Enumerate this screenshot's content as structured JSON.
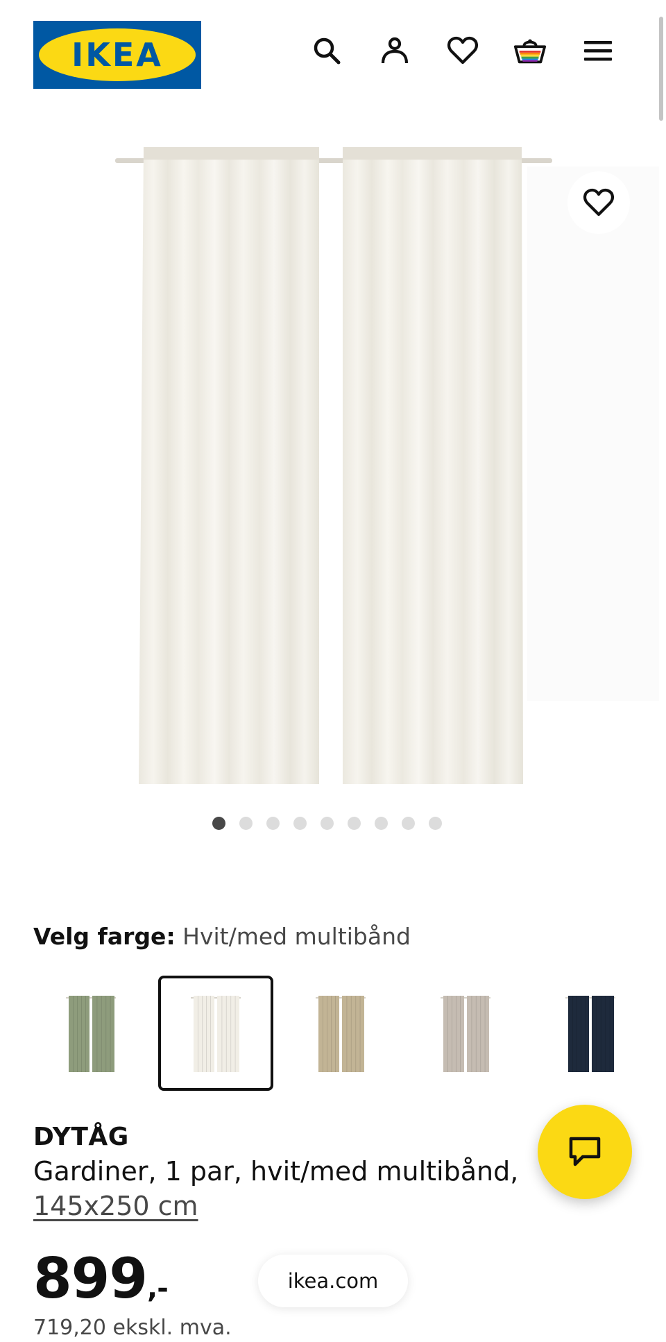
{
  "header": {
    "logo_text": "IKEA",
    "icons": [
      "search-icon",
      "profile-icon",
      "favourites-icon",
      "basket-icon",
      "menu-icon"
    ]
  },
  "gallery": {
    "dot_count": 9,
    "active_index": 0
  },
  "color_selector": {
    "label": "Velg farge:",
    "selected_value": "Hvit/med multibånd",
    "swatch_colors": [
      "#8e9c7c",
      "#f1eee6",
      "#c2b495",
      "#c5bcb2",
      "#1e2a3c"
    ],
    "selected_swatch_index": 1
  },
  "product": {
    "name": "DYTÅG",
    "description": "Gardiner, 1 par, hvit/med multibånd,",
    "size": "145x250 cm",
    "price_main": "899",
    "price_suffix": ",-",
    "price_ex_vat": "719,20 ekskl. mva."
  },
  "footer": {
    "url": "ikea.com"
  },
  "colors": {
    "brand_blue": "#0058a3",
    "brand_yellow": "#fbd914"
  }
}
